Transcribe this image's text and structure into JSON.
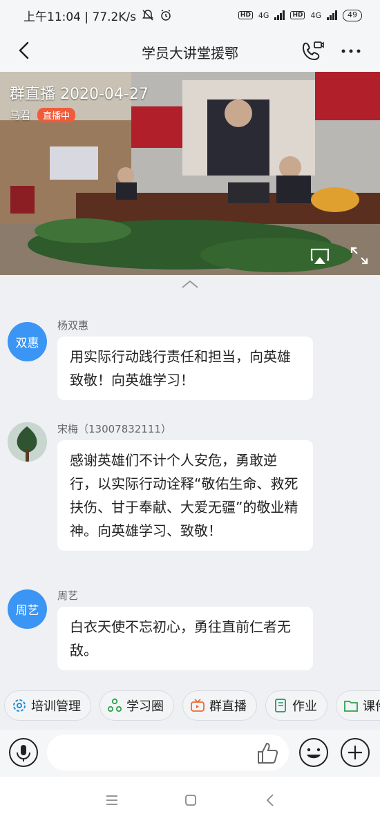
{
  "status_bar": {
    "time_speed": "上午11:04 | 77.2K/s",
    "hd1": "HD",
    "net1": "4G",
    "hd2": "HD",
    "net2": "4G",
    "battery": "49"
  },
  "nav": {
    "title": "学员大讲堂援鄂",
    "icons": [
      "back-arrow-icon",
      "video-call-icon",
      "more-dots-icon"
    ]
  },
  "live": {
    "title": "群直播 2020-04-27",
    "host": "马君",
    "badge": "直播中",
    "badge_color": "#ef5b3b",
    "icons": [
      "airplay-icon",
      "fullscreen-icon"
    ]
  },
  "messages": [
    {
      "sender": "杨双惠",
      "avatar_text": "双惠",
      "text": "用实际行动践行责任和担当，向英雄致敬！向英雄学习！"
    },
    {
      "sender": "宋梅（13007832111）",
      "avatar_text": "",
      "text": "感谢英雄们不计个人安危，勇敢逆行，以实际行动诠释“敬佑生命、救死扶伤、甘于奉献、大爱无疆”的敬业精神。向英雄学习、致敬！"
    },
    {
      "sender": "周艺",
      "avatar_text": "周艺",
      "text": "白衣天使不忘初心，勇往直前仁者无敌。"
    }
  ],
  "toolbar": [
    {
      "label": "培训管理",
      "icon": "gear-icon"
    },
    {
      "label": "学习圈",
      "icon": "circle-nodes-icon"
    },
    {
      "label": "群直播",
      "icon": "tv-icon"
    },
    {
      "label": "作业",
      "icon": "book-icon"
    },
    {
      "label": "课件",
      "icon": "folder-icon"
    }
  ],
  "input": {
    "placeholder": ""
  },
  "colors": {
    "accent": "#3a95f5",
    "toolbar_icon": "#1f8fd6",
    "live_badge": "#ef5b3b"
  }
}
